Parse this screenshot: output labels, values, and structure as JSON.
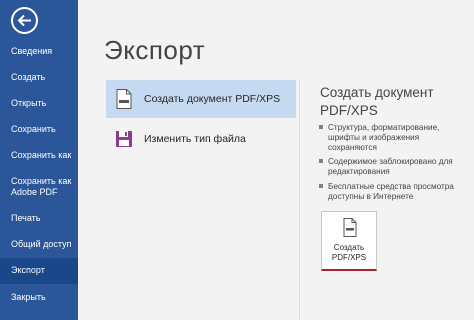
{
  "sidebar": {
    "back_icon": "back-arrow-icon",
    "items": [
      {
        "label": "Сведения"
      },
      {
        "label": "Создать"
      },
      {
        "label": "Открыть"
      },
      {
        "label": "Сохранить"
      },
      {
        "label": "Сохранить как"
      },
      {
        "label": "Сохранить как Adobe PDF"
      },
      {
        "label": "Печать"
      },
      {
        "label": "Общий доступ"
      },
      {
        "label": "Экспорт"
      },
      {
        "label": "Закрыть"
      }
    ],
    "active_item": "Экспорт"
  },
  "main": {
    "title": "Экспорт",
    "options": [
      {
        "label": "Создать документ PDF/XPS",
        "icon": "pdf-document-icon",
        "selected": true
      },
      {
        "label": "Изменить тип файла",
        "icon": "save-filetype-icon",
        "selected": false
      }
    ]
  },
  "detail": {
    "title": "Создать документ PDF/XPS",
    "bullets": [
      "Структура, форматирование, шрифты и изображения сохраняются",
      "Содержимое заблокировано для редактирования",
      "Бесплатные средства просмотра доступны в Интернете"
    ],
    "button_label": "Создать PDF/XPS",
    "button_icon": "pdf-create-icon"
  },
  "colors": {
    "sidebar": "#2b579a",
    "sidebar_active": "#19478a",
    "selected_option": "#c5d9f1",
    "button_accent": "#a4262c"
  }
}
